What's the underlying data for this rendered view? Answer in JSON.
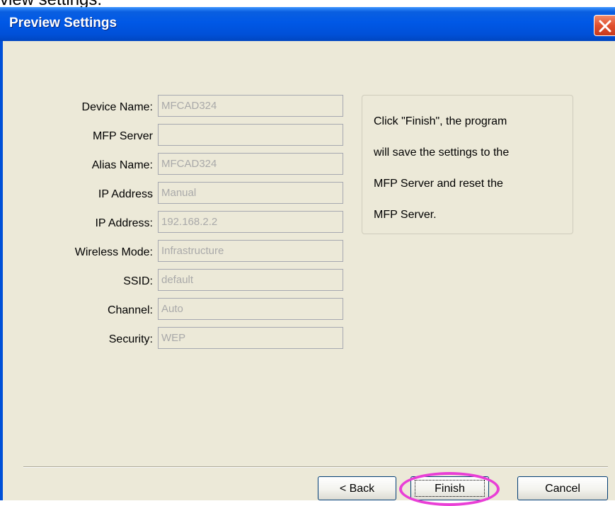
{
  "caption": "view settings.",
  "window": {
    "title": "Preview Settings",
    "close_icon": "close-icon"
  },
  "form": {
    "rows": [
      {
        "label": "Device Name:",
        "value": "MFCAD324"
      },
      {
        "label": "MFP Server",
        "value": ""
      },
      {
        "label": "Alias Name:",
        "value": "MFCAD324"
      },
      {
        "label": "IP Address",
        "value": "Manual"
      },
      {
        "label": "IP Address:",
        "value": "192.168.2.2"
      },
      {
        "label": "Wireless Mode:",
        "value": "Infrastructure"
      },
      {
        "label": "SSID:",
        "value": "default"
      },
      {
        "label": "Channel:",
        "value": "Auto"
      },
      {
        "label": "Security:",
        "value": "WEP"
      }
    ]
  },
  "info": {
    "lines": [
      "Click \"Finish\", the program",
      "will save the settings to the",
      "MFP Server and reset the",
      "MFP Server."
    ]
  },
  "buttons": {
    "back": "< Back",
    "finish": "Finish",
    "cancel": "Cancel"
  },
  "colors": {
    "titlebar": "#0058e6",
    "dialog_bg": "#ece9d8",
    "highlight": "#e93fd6"
  }
}
